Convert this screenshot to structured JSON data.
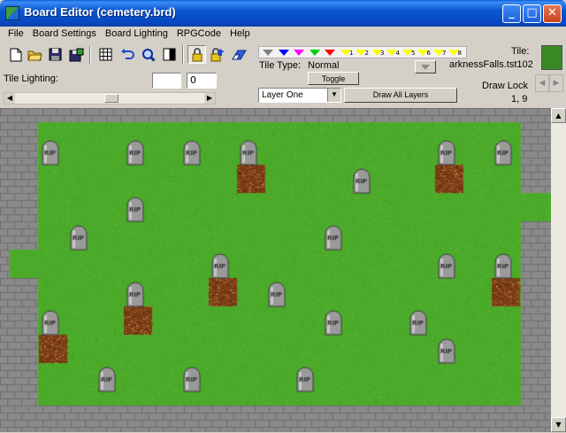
{
  "window": {
    "title": "Board Editor  (cemetery.brd)"
  },
  "menu": [
    "File",
    "Board Settings",
    "Board Lighting",
    "RPGCode",
    "Help"
  ],
  "toolbar": {
    "tools": [
      {
        "name": "new-file-icon"
      },
      {
        "name": "open-folder-icon"
      },
      {
        "name": "save-icon"
      },
      {
        "name": "save-as-icon"
      },
      {
        "name": "grid-icon"
      },
      {
        "name": "undo-icon"
      },
      {
        "name": "zoom-icon"
      },
      {
        "name": "contrast-icon"
      },
      {
        "name": "lock-icon"
      },
      {
        "name": "lock-arrow-icon"
      },
      {
        "name": "eraser-icon"
      }
    ]
  },
  "lighting": {
    "label": "Tile Lighting:",
    "value_a": "",
    "value_b": "0"
  },
  "tile_type": {
    "label": "Tile Type:",
    "value": "Normal",
    "toggle_label": "Toggle"
  },
  "layer": {
    "selected": "Layer One",
    "draw_all_label": "Draw All Layers"
  },
  "color_strip": {
    "numbers": [
      "1",
      "2",
      "3",
      "4",
      "5",
      "6",
      "7",
      "8"
    ],
    "colors": [
      "#808080",
      "#0000ff",
      "#ff00ff",
      "#00d000",
      "#ff0000",
      "#ffff00",
      "#ffff00",
      "#ffff00",
      "#ffff00",
      "#ffff00",
      "#ffff00",
      "#ffff00",
      "#ffff00"
    ]
  },
  "tile": {
    "label": "Tile:",
    "filename": "arknessFalls.tst102"
  },
  "draw_lock": {
    "label": "Draw Lock",
    "coords": "1, 9"
  },
  "tombstone_label": "RIP",
  "colors": {
    "grass": "#4caa2a",
    "wall": "#8a8a8a",
    "dirt": "#7b3d14"
  }
}
